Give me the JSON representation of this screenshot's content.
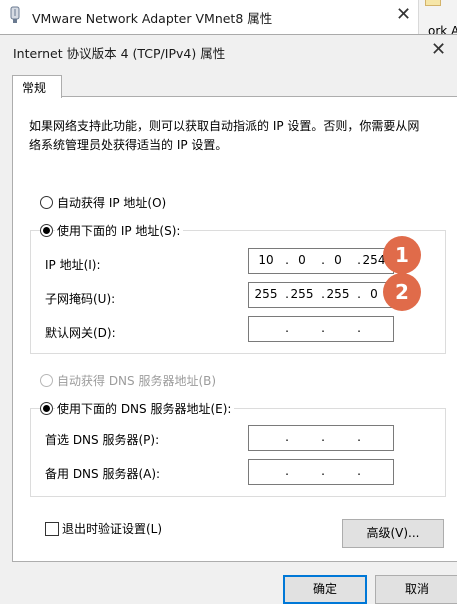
{
  "background_window": {
    "title": "VMware Network Adapter VMnet8 属性",
    "right_fragment": "ork Ad"
  },
  "dialog": {
    "title": "Internet 协议版本 4 (TCP/IPv4) 属性",
    "tab": "常规",
    "description": "如果网络支持此功能，则可以获取自动指派的 IP 设置。否则，你需要从网络系统管理员处获得适当的 IP 设置。",
    "ip_section": {
      "auto_option": "自动获得 IP 地址(O)",
      "manual_option": "使用下面的 IP 地址(S):",
      "selected": "manual",
      "fields": [
        {
          "label": "IP 地址(I):",
          "octets": [
            "10",
            "0",
            "0",
            "254"
          ]
        },
        {
          "label": "子网掩码(U):",
          "octets": [
            "255",
            "255",
            "255",
            "0"
          ]
        },
        {
          "label": "默认网关(D):",
          "octets": [
            "",
            "",
            "",
            ""
          ]
        }
      ]
    },
    "dns_section": {
      "auto_option": "自动获得 DNS 服务器地址(B)",
      "manual_option": "使用下面的 DNS 服务器地址(E):",
      "selected": "manual",
      "fields": [
        {
          "label": "首选 DNS 服务器(P):",
          "octets": [
            "",
            "",
            "",
            ""
          ]
        },
        {
          "label": "备用 DNS 服务器(A):",
          "octets": [
            "",
            "",
            "",
            ""
          ]
        }
      ]
    },
    "validate_checkbox": {
      "label": "退出时验证设置(L)",
      "checked": false
    },
    "advanced_button": "高级(V)...",
    "ok_button": "确定",
    "cancel_button": "取消"
  },
  "annotations": [
    {
      "number": "1",
      "color": "#e06b4a"
    },
    {
      "number": "2",
      "color": "#e06b4a"
    }
  ]
}
